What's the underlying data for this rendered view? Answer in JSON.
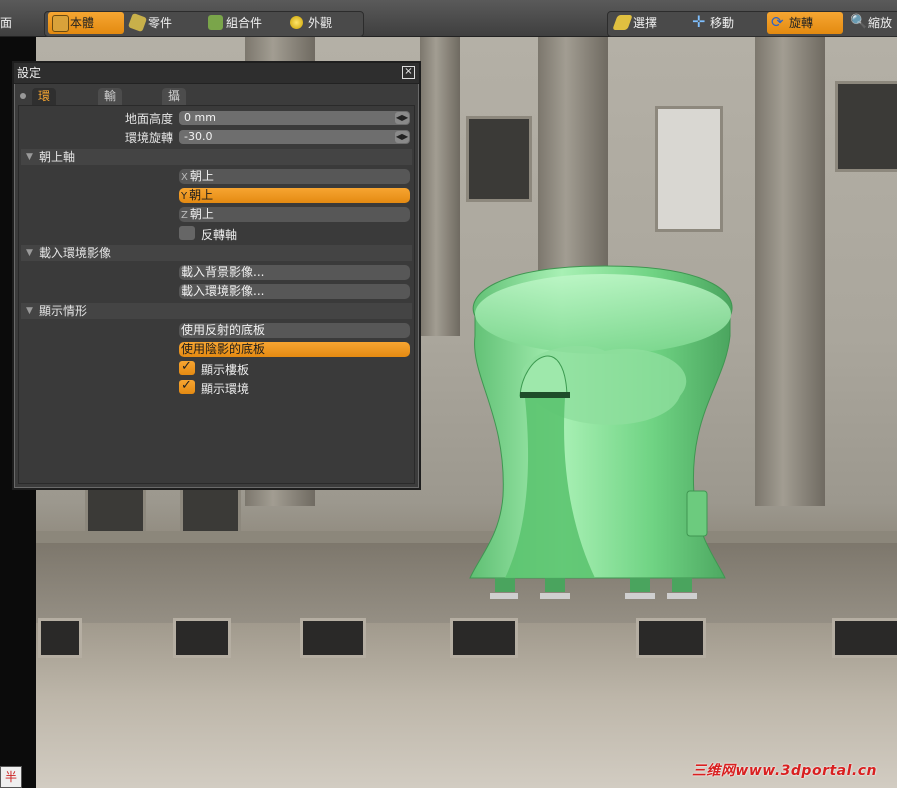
{
  "toolbar": {
    "left_cut": "面",
    "body_tab": "本體",
    "parts_tab": "零件",
    "assembly_tab": "組合件",
    "appearance_tab": "外觀",
    "select": "選擇",
    "move": "移動",
    "rotate": "旋轉",
    "zoom": "縮放"
  },
  "dialog": {
    "title": "設定",
    "close": "×",
    "tabs": [
      "環境設定",
      "輸出設定",
      "攝影機設定"
    ],
    "ground_height_label": "地面高度",
    "ground_height_value": "0 mm",
    "env_rotate_label": "環境旋轉",
    "env_rotate_value": "-30.0",
    "up_axis_section": "朝上軸",
    "up_axis_options": [
      {
        "axis": "X",
        "label": "朝上"
      },
      {
        "axis": "Y",
        "label": "朝上"
      },
      {
        "axis": "Z",
        "label": "朝上"
      }
    ],
    "invert_axis": "反轉軸",
    "load_env_section": "載入環境影像",
    "load_background": "載入背景影像...",
    "load_environment": "載入環境影像...",
    "display_section": "顯示情形",
    "use_reflective_floor": "使用反射的底板",
    "use_shadow_floor": "使用陰影的底板",
    "show_floor": "顯示樓板",
    "show_environment": "顯示環境"
  },
  "watermark": "三维网www.3dportal.cn",
  "corner_glyph": "半",
  "colors": {
    "accent": "#f6a632",
    "model": "#7fd98f"
  }
}
